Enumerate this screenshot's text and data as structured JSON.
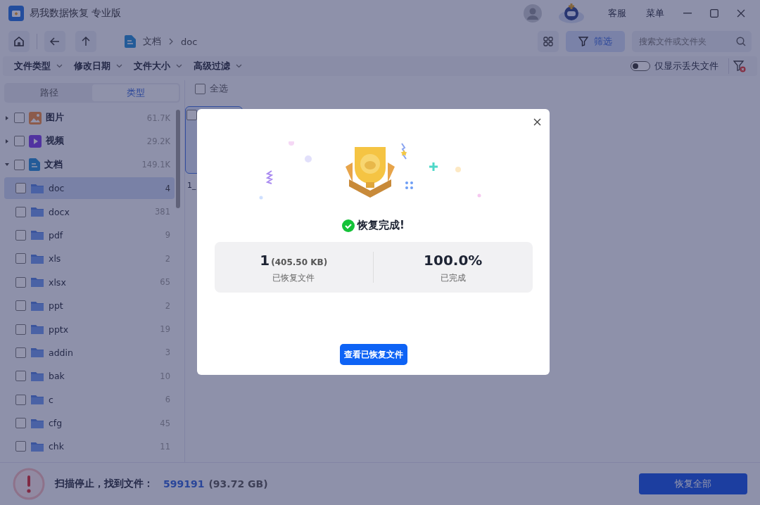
{
  "window": {
    "title": "易我数据恢复 专业版",
    "links": [
      "客服",
      "菜单"
    ]
  },
  "toolbar": {
    "breadcrumb": [
      "文档",
      "doc"
    ],
    "filter_button": {
      "label": "筛选",
      "selected": true
    },
    "search": {
      "placeholder": "搜索文件或文件夹"
    }
  },
  "filters": {
    "dropdowns": [
      "文件类型",
      "修改日期",
      "文件大小",
      "高级过滤"
    ],
    "lost_only": {
      "label": "仅显示丢失文件",
      "on": false
    }
  },
  "sidebar": {
    "tabs": [
      {
        "label": "路径",
        "selected": false
      },
      {
        "label": "类型",
        "selected": true
      }
    ],
    "tree": [
      {
        "label": "图片",
        "count": "61.7K",
        "kind": "image",
        "expanded": false,
        "checked": false
      },
      {
        "label": "视频",
        "count": "29.2K",
        "kind": "video",
        "expanded": false,
        "checked": false
      },
      {
        "label": "文档",
        "count": "149.1K",
        "kind": "document",
        "expanded": true,
        "checked": false,
        "children": [
          {
            "label": "doc",
            "count": "4",
            "checked": false,
            "selected": true
          },
          {
            "label": "docx",
            "count": "381",
            "checked": false,
            "selected": false
          },
          {
            "label": "pdf",
            "count": "9",
            "checked": false,
            "selected": false
          },
          {
            "label": "xls",
            "count": "2",
            "checked": false,
            "selected": false
          },
          {
            "label": "xlsx",
            "count": "65",
            "checked": false,
            "selected": false
          },
          {
            "label": "ppt",
            "count": "2",
            "checked": false,
            "selected": false
          },
          {
            "label": "pptx",
            "count": "19",
            "checked": false,
            "selected": false
          },
          {
            "label": "addin",
            "count": "3",
            "checked": false,
            "selected": false
          },
          {
            "label": "bak",
            "count": "10",
            "checked": false,
            "selected": false
          },
          {
            "label": "c",
            "count": "6",
            "checked": false,
            "selected": false
          },
          {
            "label": "cfg",
            "count": "45",
            "checked": false,
            "selected": false
          },
          {
            "label": "chk",
            "count": "11",
            "checked": false,
            "selected": false
          }
        ]
      }
    ]
  },
  "content": {
    "select_all": {
      "label": "全选",
      "checked": false
    },
    "files": [
      {
        "name": "1_",
        "checked": false
      }
    ]
  },
  "dialog": {
    "title": "恢复完成!",
    "stats": [
      {
        "value": "1",
        "detail": "(405.50 KB)",
        "label": "已恢复文件"
      },
      {
        "value": "100.0%",
        "label": "已完成"
      }
    ],
    "button": "查看已恢复文件"
  },
  "status_bar": {
    "message": "扫描停止，找到文件：",
    "count": "599191",
    "size": "(93.72 GB)",
    "button": "恢复全部"
  }
}
